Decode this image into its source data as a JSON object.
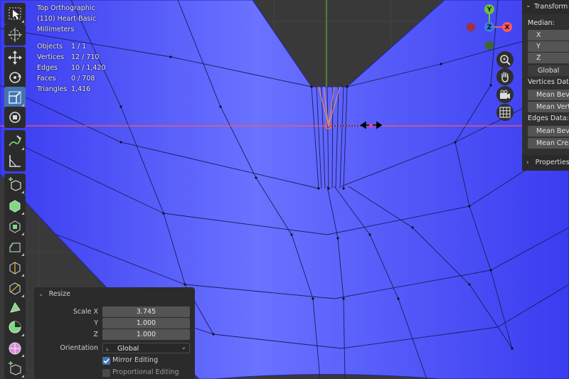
{
  "viewport": {
    "view_name": "Top Orthographic",
    "object_name": "(110) Heart-Basic",
    "units": "Millimeters",
    "stats": [
      {
        "key": "Objects",
        "value": "1 / 1"
      },
      {
        "key": "Vertices",
        "value": "12 / 710"
      },
      {
        "key": "Edges",
        "value": "10 / 1,420"
      },
      {
        "key": "Faces",
        "value": "0 / 708"
      },
      {
        "key": "Triangles",
        "value": "1,416"
      }
    ],
    "colors": {
      "mesh": "#4a4cf5",
      "x_axis": "#ff5a5a",
      "y_axis": "#6fbf3a",
      "background": "#393939"
    }
  },
  "toolbar": {
    "tools": [
      {
        "icon": "select-box-icon"
      },
      {
        "icon": "cursor-icon"
      },
      {
        "icon": "move-icon"
      },
      {
        "icon": "rotate-icon"
      },
      {
        "icon": "scale-icon",
        "active": true
      },
      {
        "icon": "transform-icon"
      },
      {
        "icon": "annotate-icon"
      },
      {
        "icon": "measure-icon"
      },
      {
        "icon": "add-cube-icon"
      },
      {
        "icon": "extrude-region-icon"
      },
      {
        "icon": "inset-faces-icon"
      },
      {
        "icon": "bevel-icon"
      },
      {
        "icon": "loop-cut-icon"
      },
      {
        "icon": "knife-icon"
      },
      {
        "icon": "poly-build-icon"
      },
      {
        "icon": "spin-icon"
      },
      {
        "icon": "smooth-icon"
      },
      {
        "icon": "shrink-fatten-icon"
      }
    ]
  },
  "nav_gizmo": {
    "axes": {
      "y": "Y",
      "z": "Z",
      "x": "X"
    },
    "buttons": [
      "zoom-icon",
      "hand-pan-icon",
      "camera-icon",
      "grid-icon"
    ]
  },
  "n_panel": {
    "transform_label": "Transform",
    "median_label": "Median:",
    "x": "X",
    "y": "Y",
    "z": "Z",
    "space": "Global",
    "vertices_data_label": "Vertices Data:",
    "mean_bevel_weight": "Mean Bevel Weight",
    "mean_vertex_crease": "Mean Vertex Crease",
    "edges_data_label": "Edges Data:",
    "mean_edge_bevel": "Mean Bevel Weight",
    "mean_crease": "Mean Crease",
    "properties_label": "Properties"
  },
  "resize_panel": {
    "title": "Resize",
    "scale_x_label": "Scale X",
    "scale_x": "3.745",
    "y_label": "Y",
    "y": "1.000",
    "z_label": "Z",
    "z": "1.000",
    "orientation_label": "Orientation",
    "orientation": "Global",
    "mirror_editing": "Mirror Editing",
    "mirror_checked": true,
    "proportional_editing": "Proportional Editing",
    "proportional_checked": false
  }
}
